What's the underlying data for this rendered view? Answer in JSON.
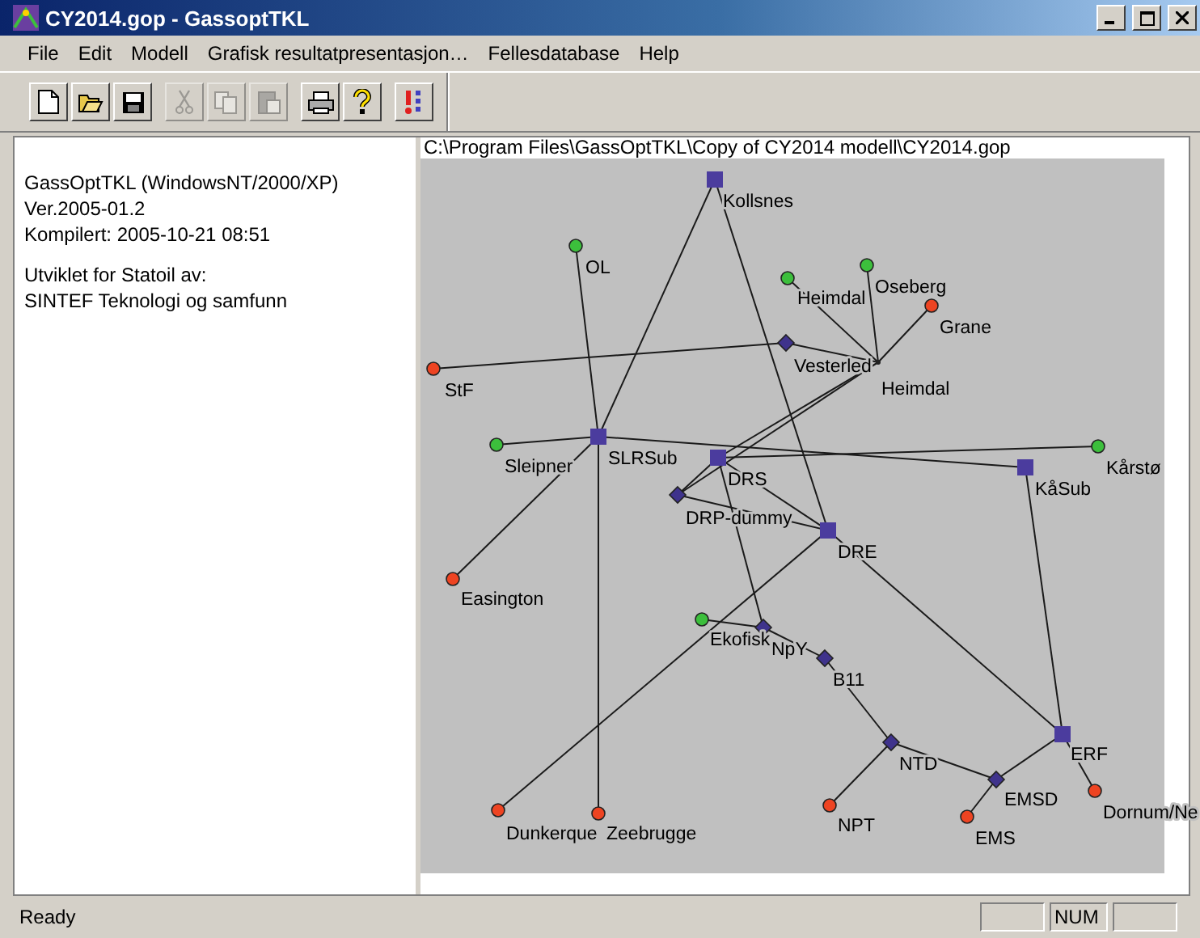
{
  "window": {
    "title": "CY2014.gop - GassoptTKL"
  },
  "menu": [
    "File",
    "Edit",
    "Modell",
    "Grafisk resultatpresentasjon…",
    "Fellesdatabase",
    "Help"
  ],
  "toolbar": [
    {
      "kind": "new",
      "disabled": false
    },
    {
      "kind": "open",
      "disabled": false
    },
    {
      "kind": "save",
      "disabled": false
    },
    {
      "kind": "cut",
      "disabled": true
    },
    {
      "kind": "copy",
      "disabled": true
    },
    {
      "kind": "paste",
      "disabled": true
    },
    {
      "kind": "print",
      "disabled": false
    },
    {
      "kind": "help",
      "disabled": false
    },
    {
      "kind": "run",
      "disabled": false
    }
  ],
  "info": {
    "lines_1": [
      "GassOptTKL (WindowsNT/2000/XP)",
      "Ver.2005-01.2",
      "Kompilert: 2005-10-21 08:51"
    ],
    "lines_2": [
      "Utviklet for Statoil av:",
      "SINTEF Teknologi og samfunn"
    ]
  },
  "file_path": "C:\\Program Files\\GassOptTKL\\Copy of CY2014 modell\\CY2014.gop",
  "nodes": [
    {
      "label": "Kollsnes",
      "kind": "hub"
    },
    {
      "label": "OL",
      "kind": "source"
    },
    {
      "label": "Heimdal",
      "kind": "source"
    },
    {
      "label": "Oseberg",
      "kind": "source"
    },
    {
      "label": "Grane",
      "kind": "terminal"
    },
    {
      "label": "Vesterled",
      "kind": "junction"
    },
    {
      "label": "Heimdal",
      "kind": "point"
    },
    {
      "label": "StF",
      "kind": "terminal"
    },
    {
      "label": "SLRSub",
      "kind": "hub"
    },
    {
      "label": "Sleipner",
      "kind": "source"
    },
    {
      "label": "DRS",
      "kind": "hub"
    },
    {
      "label": "DRP-dummy",
      "kind": "junction"
    },
    {
      "label": "KåSub",
      "kind": "hub"
    },
    {
      "label": "Kårstø",
      "kind": "source"
    },
    {
      "label": "DRE",
      "kind": "hub"
    },
    {
      "label": "Easington",
      "kind": "terminal"
    },
    {
      "label": "Ekofisk",
      "kind": "source"
    },
    {
      "label": "NpY",
      "kind": "junction"
    },
    {
      "label": "B11",
      "kind": "junction"
    },
    {
      "label": "NTD",
      "kind": "junction"
    },
    {
      "label": "ERF",
      "kind": "hub"
    },
    {
      "label": "EMSD",
      "kind": "junction"
    },
    {
      "label": "Dornum/Ne",
      "kind": "terminal"
    },
    {
      "label": "Dunkerque",
      "kind": "terminal"
    },
    {
      "label": "Zeebrugge",
      "kind": "terminal"
    },
    {
      "label": "NPT",
      "kind": "terminal"
    },
    {
      "label": "EMS",
      "kind": "terminal"
    }
  ],
  "status_bar": {
    "message": "Ready",
    "indicator": "NUM"
  }
}
